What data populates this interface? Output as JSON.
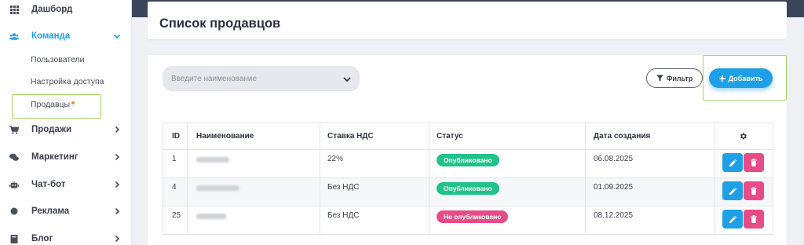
{
  "sidebar": {
    "items": [
      {
        "label": "Дашборд",
        "icon": "grid-icon"
      },
      {
        "label": "Команда",
        "icon": "users-icon"
      },
      {
        "label": "Продажи",
        "icon": "cart-icon"
      },
      {
        "label": "Маркетинг",
        "icon": "chat-bubbles-icon"
      },
      {
        "label": "Чат-бот",
        "icon": "robot-icon"
      },
      {
        "label": "Реклама",
        "icon": "circle-icon"
      },
      {
        "label": "Блог",
        "icon": "book-icon"
      }
    ],
    "team_sub": [
      {
        "label": "Пользователи"
      },
      {
        "label": "Настройка доступа"
      },
      {
        "label": "Продавцы"
      }
    ]
  },
  "header": {
    "title": "Список продавцов"
  },
  "toolbar": {
    "search_placeholder": "Введите наименование",
    "filter_label": "Фильтр",
    "add_label": "Добавить"
  },
  "table": {
    "columns": [
      "ID",
      "Наименование",
      "Ставка НДС",
      "Статус",
      "Дата создания"
    ],
    "rows": [
      {
        "id": "1",
        "vat": "22%",
        "status": "Опубликовано",
        "date": "06.08.2025"
      },
      {
        "id": "4",
        "vat": "Без НДС",
        "status": "Опубликовано",
        "date": "01.09.2025"
      },
      {
        "id": "25",
        "vat": "Без НДС",
        "status": "Не опубликовано",
        "date": "08.12.2025"
      }
    ]
  },
  "colors": {
    "accent": "#1f9fe6",
    "published": "#21c28a",
    "unpublished": "#e84b87",
    "highlight": "#a3d65c"
  }
}
